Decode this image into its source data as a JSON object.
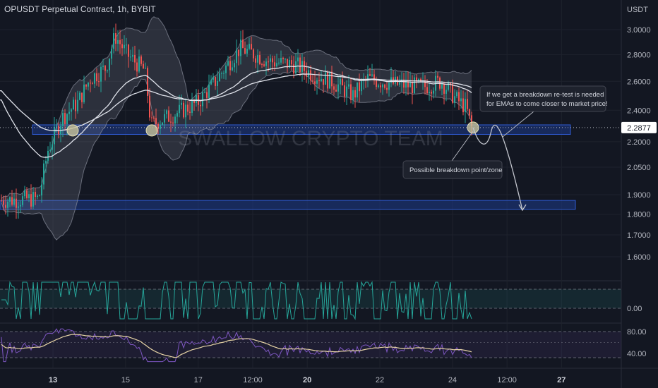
{
  "header": {
    "title": "OPUSDT Perpetual Contract, 1h, BYBIT",
    "currency": "USDT"
  },
  "watermark": "SWALLOW CRYPTO TEAM",
  "last_price": {
    "value": 2.2877,
    "label": "2.2877"
  },
  "annotations": {
    "retest_note": [
      "If we get a breakdown re-test is needed",
      "for EMAs to come closer to market price!"
    ],
    "breakdown_note": "Possible breakdown point/zone"
  },
  "colors": {
    "background": "#131722",
    "up": "#26a69a",
    "down": "#ef5350",
    "zone": "#1e3a8a",
    "zone_border": "#2f5bd3",
    "band": "#8a8f9c",
    "ema": "#e0e3eb",
    "macd": "#26a69a",
    "rsi": "#7e57c2",
    "rsi_ma": "#e8d5a6",
    "circle": "#c8c39a"
  },
  "chart_data": [
    {
      "type": "candlestick",
      "title": "OPUSDT Perpetual Contract, 1h, BYBIT",
      "ylabel": "USDT",
      "y_scale": "log",
      "ylim": [
        1.5,
        3.1
      ],
      "y_ticks": [
        3.0,
        2.8,
        2.6,
        2.4,
        2.2,
        2.05,
        1.9,
        1.8,
        1.7,
        1.6
      ],
      "y_tick_labels": [
        "3.0000",
        "2.8000",
        "2.6000",
        "2.4000",
        "2.2000",
        "2.0500",
        "1.9000",
        "1.8000",
        "1.7000",
        "1.6000"
      ],
      "x_ticks": [
        "13",
        "15",
        "17",
        "12:00",
        "20",
        "22",
        "24",
        "12:00",
        "27"
      ],
      "x_tick_bold": [
        true,
        false,
        false,
        false,
        true,
        false,
        false,
        false,
        true
      ],
      "close_path": [
        [
          "13",
          1.87
        ],
        [
          "13",
          2.15
        ],
        [
          "13",
          2.3
        ],
        [
          "14",
          2.4
        ],
        [
          "14",
          2.62
        ],
        [
          "15",
          2.95
        ],
        [
          "15",
          2.75
        ],
        [
          "16",
          2.55
        ],
        [
          "16",
          2.33
        ],
        [
          "16",
          2.38
        ],
        [
          "17",
          2.42
        ],
        [
          "17",
          2.48
        ],
        [
          "18",
          2.62
        ],
        [
          "19",
          2.85
        ],
        [
          "19",
          2.75
        ],
        [
          "20",
          2.72
        ],
        [
          "20",
          2.66
        ],
        [
          "21",
          2.58
        ],
        [
          "21",
          2.52
        ],
        [
          "22",
          2.6
        ],
        [
          "23",
          2.56
        ],
        [
          "23",
          2.58
        ],
        [
          "24",
          2.5
        ],
        [
          "24",
          2.2877
        ]
      ],
      "support_zones": [
        {
          "from": 2.245,
          "to": 2.305,
          "label": ""
        },
        {
          "from": 1.825,
          "to": 1.87,
          "label": ""
        }
      ],
      "projection": [
        2.2877,
        2.2,
        2.26,
        1.82
      ],
      "grid": true
    },
    {
      "type": "line",
      "title": "",
      "y_ticks": [
        0.0
      ],
      "y_tick_labels": [
        "0.00"
      ]
    },
    {
      "type": "line",
      "title": "",
      "y_ticks": [
        80,
        40
      ],
      "y_tick_labels": [
        "80.00",
        "40.00"
      ],
      "ylim": [
        20,
        90
      ]
    }
  ]
}
